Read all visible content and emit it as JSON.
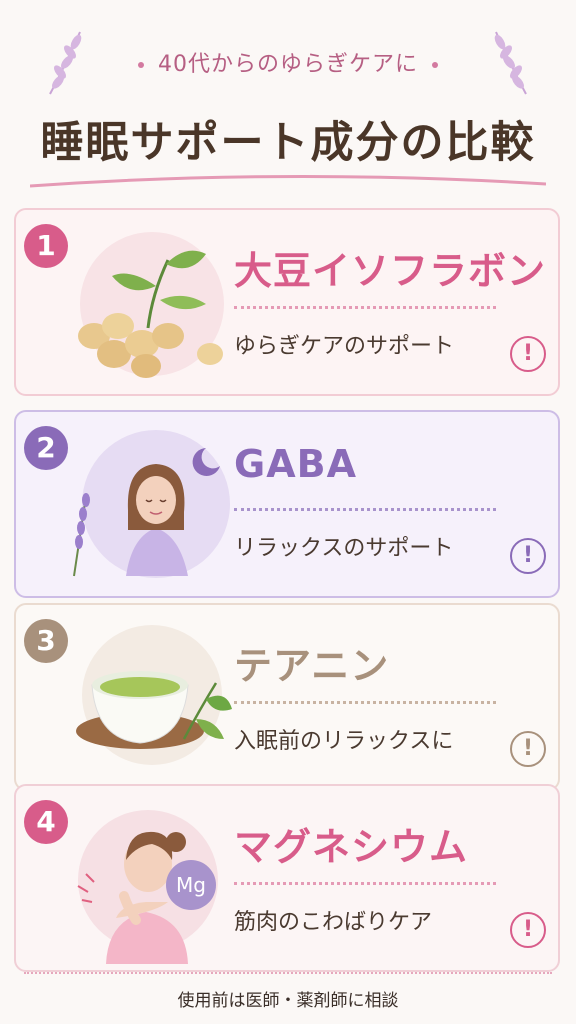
{
  "header": {
    "subtitle": "40代からのゆらぎケアに",
    "title": "睡眠サポート成分の比較"
  },
  "items": [
    {
      "number": "1",
      "name": "大豆イソフラボン",
      "description": "ゆらぎケアのサポート",
      "alert": "!",
      "accent": "#d85c8a",
      "illustration": "soybeans-with-leaves-icon"
    },
    {
      "number": "2",
      "name": "GABA",
      "description": "リラックスのサポート",
      "alert": "!",
      "accent": "#8a6bb8",
      "illustration": "relaxed-woman-with-lavender-icon"
    },
    {
      "number": "3",
      "name": "テアニン",
      "description": "入眠前のリラックスに",
      "alert": "!",
      "accent": "#a8917c",
      "illustration": "green-tea-cup-icon"
    },
    {
      "number": "4",
      "name": "マグネシウム",
      "description": "筋肉のこわばりケア",
      "alert": "!",
      "accent": "#d85c8a",
      "illustration": "woman-shoulder-massage-icon",
      "badge": "Mg"
    }
  ],
  "footer": {
    "note": "使用前は医師・薬剤師に相談"
  }
}
